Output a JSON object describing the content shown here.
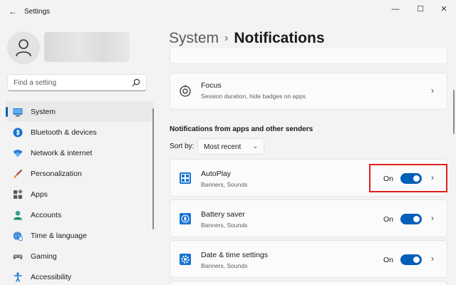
{
  "window": {
    "title": "Settings",
    "controls": {
      "minimize": "—",
      "maximize": "☐",
      "close": "✕"
    }
  },
  "search": {
    "placeholder": "Find a setting"
  },
  "sidebar": {
    "items": [
      {
        "label": "System",
        "icon": "monitor-icon",
        "active": true
      },
      {
        "label": "Bluetooth & devices",
        "icon": "bluetooth-icon"
      },
      {
        "label": "Network & internet",
        "icon": "wifi-icon"
      },
      {
        "label": "Personalization",
        "icon": "brush-icon"
      },
      {
        "label": "Apps",
        "icon": "apps-icon"
      },
      {
        "label": "Accounts",
        "icon": "person-icon"
      },
      {
        "label": "Time & language",
        "icon": "globe-clock-icon"
      },
      {
        "label": "Gaming",
        "icon": "gamepad-icon"
      },
      {
        "label": "Accessibility",
        "icon": "accessibility-icon"
      }
    ]
  },
  "breadcrumb": {
    "parent": "System",
    "separator": "›",
    "current": "Notifications"
  },
  "focus": {
    "title": "Focus",
    "subtitle": "Session duration, hide badges on apps"
  },
  "section": {
    "header": "Notifications from apps and other senders"
  },
  "sort": {
    "label": "Sort by:",
    "value": "Most recent"
  },
  "senders": [
    {
      "name": "AutoPlay",
      "sub": "Banners, Sounds",
      "state": "On",
      "on": true,
      "highlighted": true
    },
    {
      "name": "Battery saver",
      "sub": "Banners, Sounds",
      "state": "On",
      "on": true
    },
    {
      "name": "Date & time settings",
      "sub": "Banners, Sounds",
      "state": "On",
      "on": true
    }
  ],
  "colors": {
    "accent": "#005fb8",
    "highlight": "#e0201b",
    "background": "#f3f3f3",
    "card": "#fbfbfb"
  }
}
